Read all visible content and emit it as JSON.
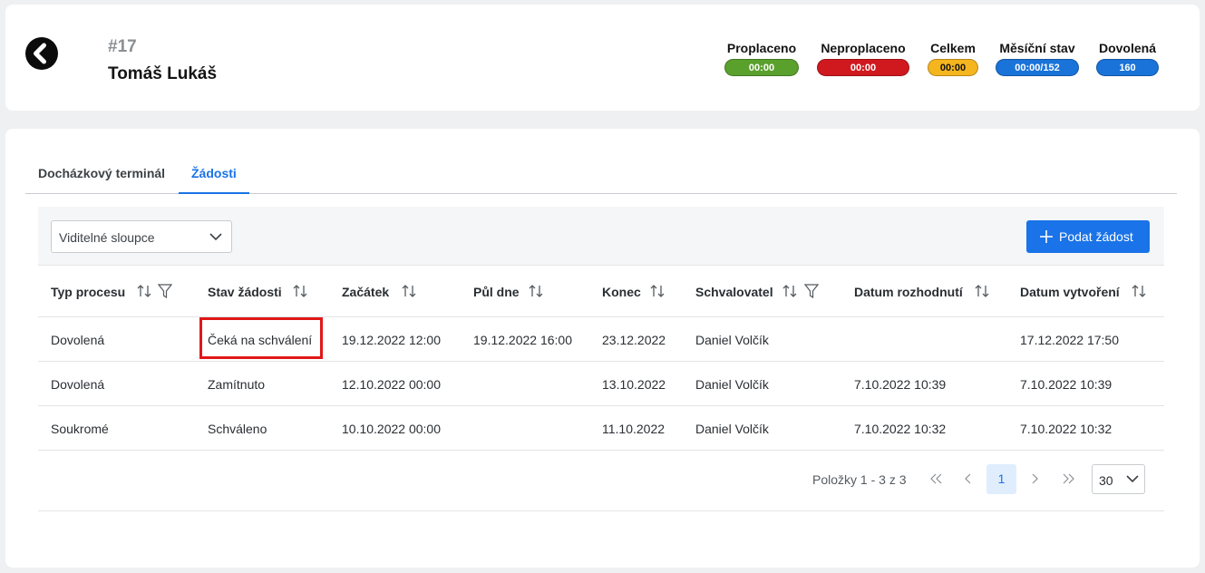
{
  "header": {
    "number": "#17",
    "name": "Tomáš Lukáš"
  },
  "stats": [
    {
      "label": "Proplaceno",
      "value": "00:00",
      "color": "#5aa02c"
    },
    {
      "label": "Neproplaceno",
      "value": "00:00",
      "color": "#d0191f"
    },
    {
      "label": "Celkem",
      "value": "00:00",
      "color": "#f5b51f"
    },
    {
      "label": "Měsíční stav",
      "value": "00:00/152",
      "color": "#1a73d9"
    },
    {
      "label": "Dovolená",
      "value": "160",
      "color": "#1a73d9"
    }
  ],
  "tabs": [
    {
      "label": "Docházkový terminál",
      "active": false
    },
    {
      "label": "Žádosti",
      "active": true
    }
  ],
  "toolbar": {
    "columns_select": "Viditelné sloupce",
    "submit_button": "Podat žádost"
  },
  "table": {
    "columns": [
      "Typ procesu",
      "Stav žádosti",
      "Začátek",
      "Půl dne",
      "Konec",
      "Schvalovatel",
      "Datum rozhodnutí",
      "Datum vytvoření"
    ],
    "rows": [
      [
        "Dovolená",
        "Čeká na schválení",
        "19.12.2022 12:00",
        "19.12.2022 16:00",
        "23.12.2022",
        "Daniel Volčík",
        "",
        "17.12.2022 17:50"
      ],
      [
        "Dovolená",
        "Zamítnuto",
        "12.10.2022 00:00",
        "",
        "13.10.2022",
        "Daniel Volčík",
        "7.10.2022 10:39",
        "7.10.2022 10:39"
      ],
      [
        "Soukromé",
        "Schváleno",
        "10.10.2022 00:00",
        "",
        "11.10.2022",
        "Daniel Volčík",
        "7.10.2022 10:32",
        "7.10.2022 10:32"
      ]
    ]
  },
  "pager": {
    "info": "Položky 1 - 3 z 3",
    "current_page": "1",
    "page_size": "30"
  },
  "colors": {
    "accent": "#1a73e8",
    "highlight": "#e01818"
  }
}
